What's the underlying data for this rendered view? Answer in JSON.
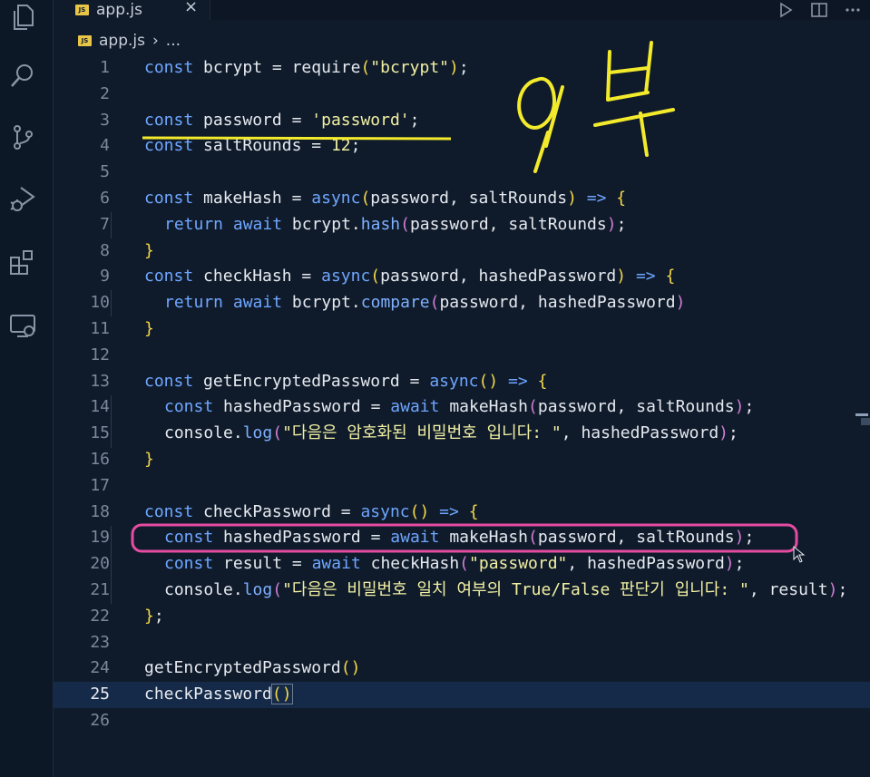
{
  "tab": {
    "badge": "JS",
    "title": "app.js",
    "close": "×"
  },
  "breadcrumb": {
    "badge": "JS",
    "file": "app.js",
    "sep": "›",
    "more": "..."
  },
  "activity": [
    "files-icon",
    "search-icon",
    "source-control-icon",
    "run-debug-icon",
    "extensions-icon",
    "remote-explorer-icon"
  ],
  "editor_actions": [
    "run-icon",
    "split-editor-icon",
    "more-actions-icon"
  ],
  "current_line": 25,
  "code": [
    [
      [
        "k",
        "const"
      ],
      [
        "",
        "bcrypt"
      ],
      [
        "",
        "="
      ],
      [
        "",
        "require"
      ],
      [
        "b1",
        "("
      ],
      [
        "s",
        "\"bcrypt\""
      ],
      [
        "b1",
        ")"
      ],
      [
        "",
        ";"
      ]
    ],
    [],
    [
      [
        "k",
        "const"
      ],
      [
        "",
        "password"
      ],
      [
        "",
        "="
      ],
      [
        "s",
        "'password'"
      ],
      [
        "",
        ";"
      ]
    ],
    [
      [
        "k",
        "const"
      ],
      [
        "",
        "saltRounds"
      ],
      [
        "",
        "="
      ],
      [
        "n",
        "12"
      ],
      [
        "",
        ";"
      ]
    ],
    [],
    [
      [
        "k",
        "const"
      ],
      [
        "",
        "makeHash"
      ],
      [
        "",
        "="
      ],
      [
        "k",
        "async"
      ],
      [
        "b1",
        "("
      ],
      [
        "",
        "password,"
      ],
      [
        "",
        "saltRounds"
      ],
      [
        "b1",
        ")"
      ],
      [
        "k",
        "=>"
      ],
      [
        "b1",
        "{"
      ]
    ],
    [
      [
        "k",
        "return"
      ],
      [
        "k",
        "await"
      ],
      [
        "",
        "bcrypt."
      ],
      [
        "f",
        "hash"
      ],
      [
        "b2",
        "("
      ],
      [
        "",
        "password,"
      ],
      [
        "",
        "saltRounds"
      ],
      [
        "b2",
        ")"
      ],
      [
        "",
        ";"
      ]
    ],
    [
      [
        "b1",
        "}"
      ]
    ],
    [
      [
        "k",
        "const"
      ],
      [
        "",
        "checkHash"
      ],
      [
        "",
        "="
      ],
      [
        "k",
        "async"
      ],
      [
        "b1",
        "("
      ],
      [
        "",
        "password,"
      ],
      [
        "",
        "hashedPassword"
      ],
      [
        "b1",
        ")"
      ],
      [
        "k",
        "=>"
      ],
      [
        "b1",
        "{"
      ]
    ],
    [
      [
        "k",
        "return"
      ],
      [
        "k",
        "await"
      ],
      [
        "",
        "bcrypt."
      ],
      [
        "f",
        "compare"
      ],
      [
        "b2",
        "("
      ],
      [
        "",
        "password,"
      ],
      [
        "",
        "hashedPassword"
      ],
      [
        "b2",
        ")"
      ]
    ],
    [
      [
        "b1",
        "}"
      ]
    ],
    [],
    [
      [
        "k",
        "const"
      ],
      [
        "",
        "getEncryptedPassword"
      ],
      [
        "",
        "="
      ],
      [
        "k",
        "async"
      ],
      [
        "b1",
        "()"
      ],
      [
        "k",
        "=>"
      ],
      [
        "b1",
        "{"
      ]
    ],
    [
      [
        "k",
        "const"
      ],
      [
        "",
        "hashedPassword"
      ],
      [
        "",
        "="
      ],
      [
        "k",
        "await"
      ],
      [
        "",
        "makeHash"
      ],
      [
        "b2",
        "("
      ],
      [
        "",
        "password,"
      ],
      [
        "",
        "saltRounds"
      ],
      [
        "b2",
        ")"
      ],
      [
        "",
        ";"
      ]
    ],
    [
      [
        "",
        "console."
      ],
      [
        "f",
        "log"
      ],
      [
        "b2",
        "("
      ],
      [
        "s",
        "\"다음은 암호화된 비밀번호 입니다: \""
      ],
      [
        "",
        ","
      ],
      [
        "",
        "hashedPassword"
      ],
      [
        "b2",
        ")"
      ],
      [
        "",
        ";"
      ]
    ],
    [
      [
        "b1",
        "}"
      ]
    ],
    [],
    [
      [
        "k",
        "const"
      ],
      [
        "",
        "checkPassword"
      ],
      [
        "",
        "="
      ],
      [
        "k",
        "async"
      ],
      [
        "b1",
        "()"
      ],
      [
        "k",
        "=>"
      ],
      [
        "b1",
        "{"
      ]
    ],
    [
      [
        "k",
        "const"
      ],
      [
        "",
        "hashedPassword"
      ],
      [
        "",
        "="
      ],
      [
        "k",
        "await"
      ],
      [
        "",
        "makeHash"
      ],
      [
        "b2",
        "("
      ],
      [
        "",
        "password,"
      ],
      [
        "",
        "saltRounds"
      ],
      [
        "b2",
        ")"
      ],
      [
        "",
        ";"
      ]
    ],
    [
      [
        "k",
        "const"
      ],
      [
        "",
        "result"
      ],
      [
        "",
        "="
      ],
      [
        "k",
        "await"
      ],
      [
        "",
        "checkHash"
      ],
      [
        "b2",
        "("
      ],
      [
        "s",
        "\"password\""
      ],
      [
        "",
        ","
      ],
      [
        "",
        "hashedPassword"
      ],
      [
        "b2",
        ")"
      ],
      [
        "",
        ";"
      ]
    ],
    [
      [
        "",
        "console."
      ],
      [
        "f",
        "log"
      ],
      [
        "b2",
        "("
      ],
      [
        "s",
        "\"다음은 비밀번호 일치 여부의 True/False 판단기 입니다: \""
      ],
      [
        "",
        ","
      ],
      [
        "",
        "result"
      ],
      [
        "b2",
        ")"
      ],
      [
        "",
        ";"
      ]
    ],
    [
      [
        "b1",
        "}"
      ],
      [
        "",
        ";"
      ]
    ],
    [],
    [
      [
        "",
        "getEncryptedPassword"
      ],
      [
        "b1",
        "()"
      ]
    ],
    [
      [
        "",
        "checkPassword"
      ],
      [
        "b1",
        "()"
      ]
    ],
    []
  ],
  "annotation": {
    "handwriting": "외부"
  }
}
